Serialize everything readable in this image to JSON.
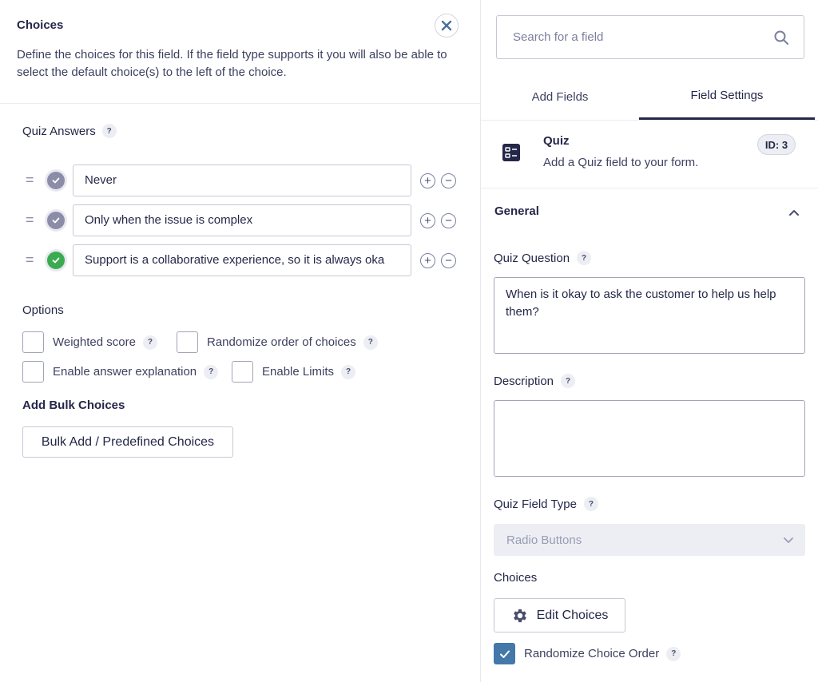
{
  "choices_panel": {
    "title": "Choices",
    "description": "Define the choices for this field. If the field type supports it you will also be able to select the default choice(s) to the left of the choice.",
    "quiz_answers_label": "Quiz Answers",
    "help_glyph": "?",
    "drag_glyph": "=",
    "plus_glyph": "+",
    "minus_glyph": "−",
    "choices": [
      {
        "text": "Never",
        "correct": false
      },
      {
        "text": "Only when the issue is complex",
        "correct": false
      },
      {
        "text": "Support is a collaborative experience, so it is always oka",
        "correct": true
      }
    ],
    "options_title": "Options",
    "options": {
      "weighted_score": "Weighted score",
      "randomize_order": "Randomize order of choices",
      "answer_explanation": "Enable answer explanation",
      "enable_limits": "Enable Limits"
    },
    "bulk_title": "Add Bulk Choices",
    "bulk_button": "Bulk Add / Predefined Choices"
  },
  "sidebar": {
    "search_placeholder": "Search for a field",
    "tabs": [
      {
        "label": "Add Fields",
        "active": false
      },
      {
        "label": "Field Settings",
        "active": true
      }
    ],
    "field": {
      "title": "Quiz",
      "description": "Add a Quiz field to your form.",
      "id_badge": "ID: 3"
    },
    "general_title": "General",
    "quiz_question_label": "Quiz Question",
    "quiz_question_value": "When is it okay to ask the customer to help us help them?",
    "description_label": "Description",
    "description_value": "",
    "quiz_field_type_label": "Quiz Field Type",
    "quiz_field_type_value": "Radio Buttons",
    "choices_label": "Choices",
    "edit_choices_button": "Edit Choices",
    "randomize_choice_order_label": "Randomize Choice Order",
    "randomize_choice_order_checked": true
  },
  "colors": {
    "text": "#242748",
    "correct": "#3bab52",
    "incorrect": "#8b8ca8",
    "checkbox_checked": "#4478a9"
  }
}
